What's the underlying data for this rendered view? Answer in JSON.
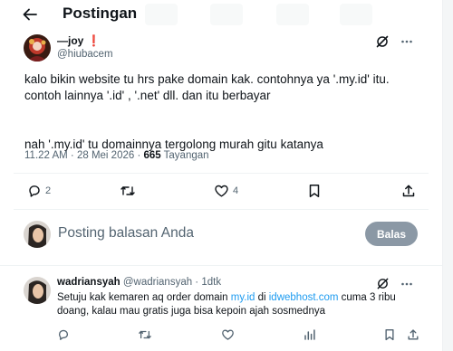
{
  "header": {
    "title": "Postingan"
  },
  "post": {
    "display_name": "—joy",
    "badge": "❗",
    "handle": "@hiubacem",
    "line1": "kalo bikin website tu hrs pake domain kak. contohnya ya '.my.id' itu.",
    "line2": "contoh lainnya '.id' , '.net' dll. dan itu berbayar",
    "line3": "nah '.my.id' tu domainnya tergolong murah gitu katanya",
    "timestamp": "11.22 AM · 28 Mei 2026 · ",
    "views_count": "665",
    "views_label": " Tayangan",
    "replies": "2",
    "likes": "4"
  },
  "compose": {
    "placeholder": "Posting balasan Anda",
    "button_label": "Balas"
  },
  "reply": {
    "display_name": "wadriansyah",
    "handle_time": "@wadriansyah · 1dtk",
    "text_1": "Setuju kak kemaren aq order domain ",
    "link_1": "my.id",
    "text_2": " di ",
    "link_2": "idwebhost.com",
    "text_3": " cuma 3 ribu doang, kalau mau gratis juga bisa kepoin ajah sosmednya"
  },
  "colors": {
    "accent": "#1d9bf0",
    "text": "#0f1419",
    "muted": "#536471",
    "button_disabled": "#8b98a5",
    "badge": "#e0245e"
  },
  "icons": [
    "back-arrow-icon",
    "grok-icon",
    "more-icon",
    "reply-icon",
    "retweet-icon",
    "like-icon",
    "bookmark-icon",
    "share-icon",
    "views-icon"
  ]
}
